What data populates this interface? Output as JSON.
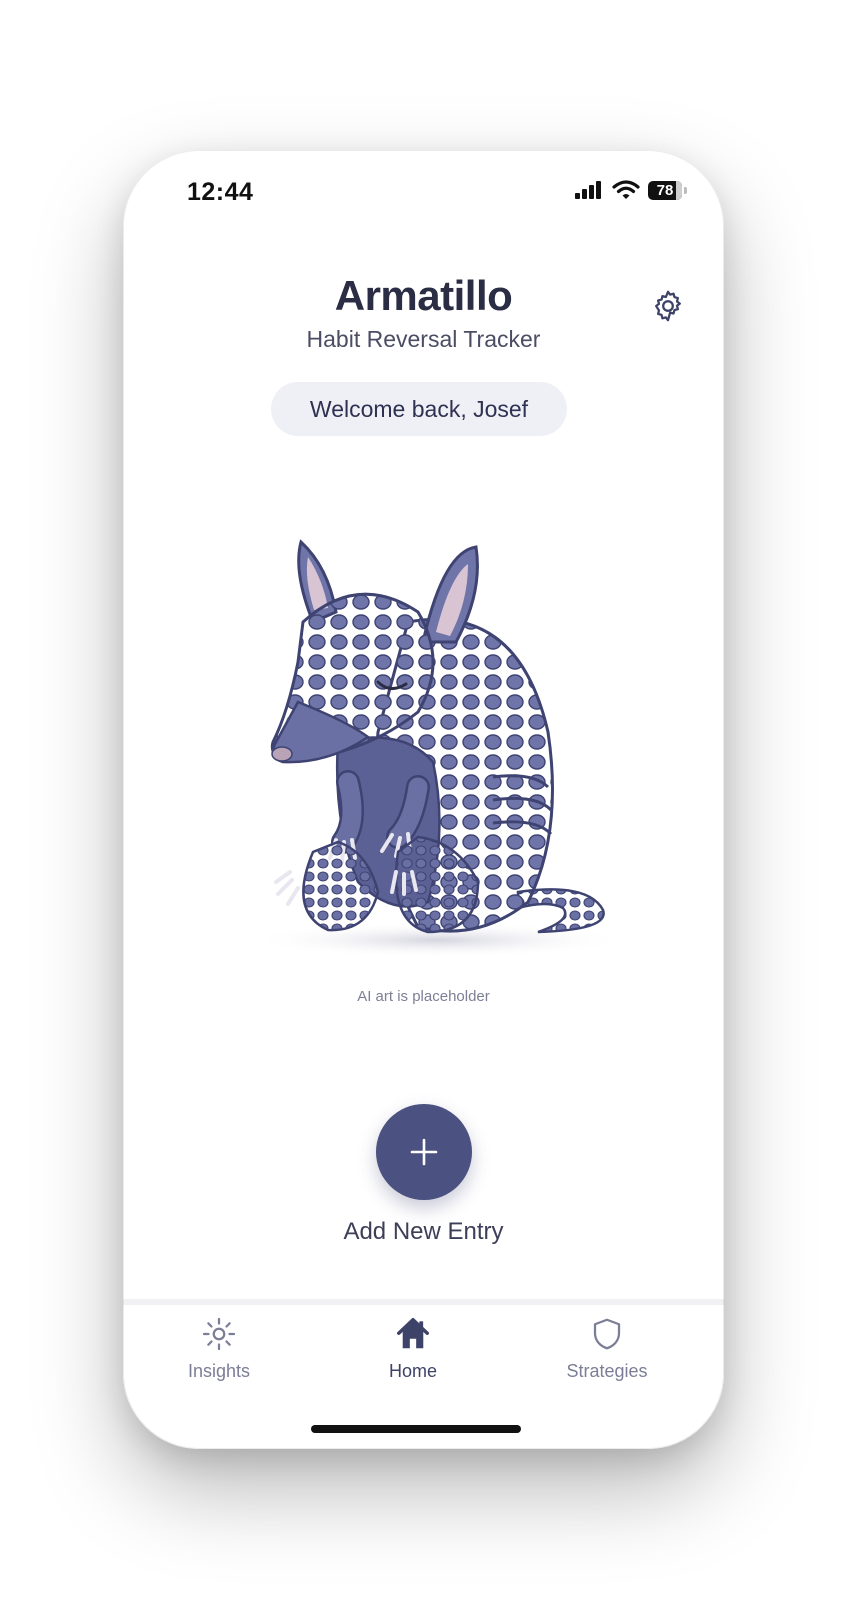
{
  "status_bar": {
    "time": "12:44",
    "battery": "78",
    "icons": [
      "signal-icon",
      "wifi-icon",
      "battery-icon"
    ]
  },
  "header": {
    "title": "Armatillo",
    "subtitle": "Habit Reversal Tracker",
    "settings_icon": "gear-icon"
  },
  "welcome": {
    "text": "Welcome back, Josef"
  },
  "mascot": {
    "caption": "AI art is placeholder",
    "icon": "armadillo-illustration"
  },
  "add_entry": {
    "label": "Add New Entry",
    "icon": "plus-icon"
  },
  "tabs": [
    {
      "label": "Insights",
      "icon": "sun-icon",
      "active": false
    },
    {
      "label": "Home",
      "icon": "home-icon",
      "active": true
    },
    {
      "label": "Strategies",
      "icon": "shield-icon",
      "active": false
    }
  ],
  "colors": {
    "accent": "#4b5180",
    "title": "#2b2d45",
    "pill_bg": "#eff0f6",
    "inactive_tab": "#7b7e96"
  }
}
